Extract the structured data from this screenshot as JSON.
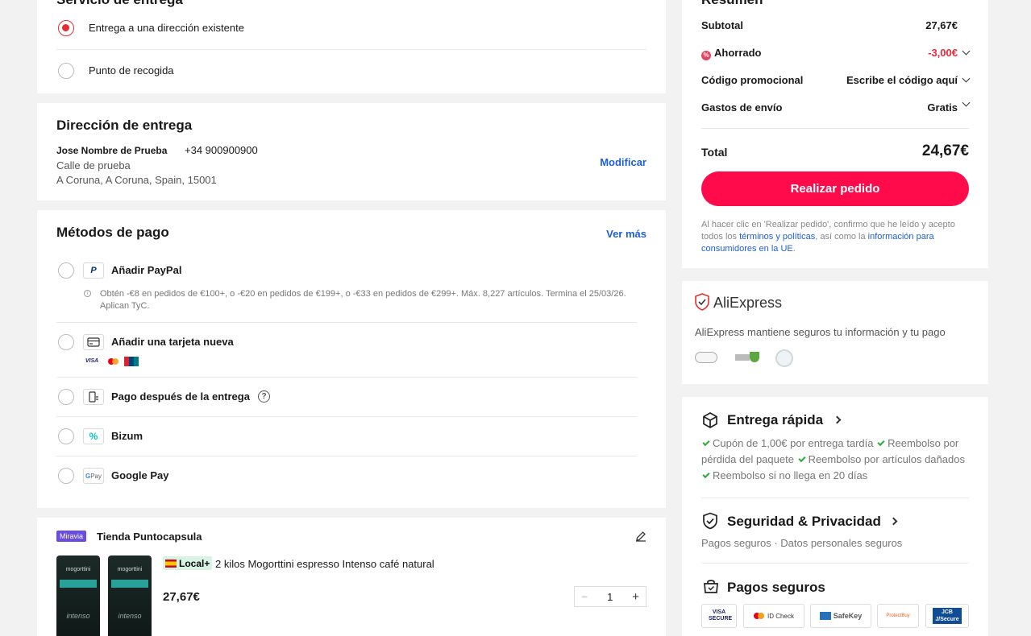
{
  "delivery_service": {
    "title": "Servicio de entrega",
    "options": [
      {
        "label": "Entrega a una dirección existente",
        "selected": true
      },
      {
        "label": "Punto de recogida",
        "selected": false
      }
    ]
  },
  "address": {
    "title": "Dirección de entrega",
    "name": "Jose Nombre de Prueba",
    "phone": "+34 900900900",
    "street": "Calle de prueba",
    "city": "A Coruna, A Coruna, Spain, 15001",
    "modify_label": "Modificar"
  },
  "payment": {
    "title": "Métodos de pago",
    "see_more": "Ver más",
    "paypal_label": "Añadir PayPal",
    "paypal_promo": "Obtén -€8 en pedidos de €100+, o -€20 en pedidos de €199+, o -€33 en pedidos de €299+. Máx. 8,227 artículos. Termina el 25/03/26. Aplican TyC.",
    "card_label": "Añadir una tarjeta nueva",
    "cod_label": "Pago después de la entrega",
    "bizum_label": "Bizum",
    "gpay_label": "Google Pay",
    "card_brands": [
      "VISA",
      "Mastercard",
      "UnionPay"
    ]
  },
  "store": {
    "badge": "Miravia",
    "name": "Tienda Puntocapsula",
    "local_badge": "Local+",
    "product_name": "2 kilos Mogorttini espresso Intenso café natural",
    "price": "27,67€",
    "quantity": "1",
    "minus": "−",
    "plus": "+",
    "product_brand": "mogorttini",
    "product_variant": "intenso"
  },
  "summary": {
    "title": "Resumen",
    "subtotal_label": "Subtotal",
    "subtotal_value": "27,67€",
    "saved_label": "Ahorrado",
    "saved_value": "-3,00€",
    "promo_label": "Código promocional",
    "promo_value": "Escribe el código aquí",
    "shipping_label": "Gastos de envío",
    "shipping_value": "Gratis",
    "total_label": "Total",
    "total_value": "24,67€",
    "order_button": "Realizar pedido",
    "legal_1": "Al hacer clic en 'Realizar pedido', confirmo que he leído y acepto todos los ",
    "legal_link1": "términos y políticas",
    "legal_2": ", así como la ",
    "legal_link2": "información para consumidores en la UE",
    "legal_3": "."
  },
  "trust": {
    "brand": "AliExpress",
    "text": "AliExpress mantiene seguros tu información y tu pago"
  },
  "fast_delivery": {
    "title": "Entrega rápida",
    "items": [
      "Cupón de 1,00€ por entrega tardía",
      "Reembolso por pérdida del paquete",
      "Reembolso por artículos dañados",
      "Reembolso si no llega en 20 días"
    ]
  },
  "security": {
    "title": "Seguridad & Privacidad",
    "text": "Pagos seguros · Datos personales seguros"
  },
  "secure_payments": {
    "title": "Pagos seguros",
    "badges": [
      "VISA SECURE",
      "ID Check",
      "SafeKey",
      "ProtectBuy",
      "JCB J/Secure"
    ]
  },
  "colors": {
    "accent": "#ff0a4a",
    "link": "#1f5fd6",
    "radio": "#e62e2e"
  }
}
